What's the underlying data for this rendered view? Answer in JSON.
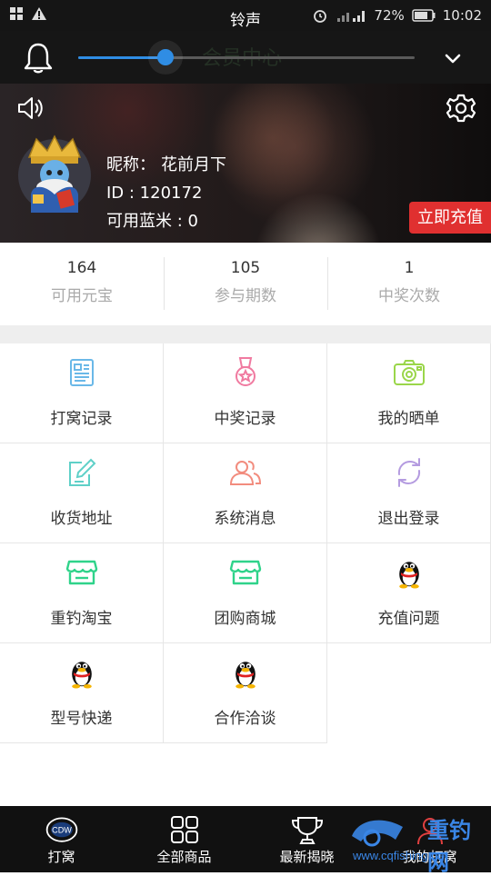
{
  "status_bar": {
    "title": "铃声",
    "battery": "72%",
    "time": "10:02"
  },
  "volume": {
    "level_fraction": 0.26
  },
  "header": {
    "page_title_ghost": "会员中心",
    "nickname_label": "昵称：",
    "nickname": "花前月下",
    "id_text": "ID : 120172",
    "balance_text": "可用蓝米 : 0",
    "recharge_button": "立即充值"
  },
  "stats": [
    {
      "value": "164",
      "label": "可用元宝"
    },
    {
      "value": "105",
      "label": "参与期数"
    },
    {
      "value": "1",
      "label": "中奖次数"
    }
  ],
  "menu": [
    {
      "label": "打窝记录",
      "icon": "document-icon",
      "color": "#6ab8e8"
    },
    {
      "label": "中奖记录",
      "icon": "medal-icon",
      "color": "#f07aa0"
    },
    {
      "label": "我的晒单",
      "icon": "camera-icon",
      "color": "#9ad64a"
    },
    {
      "label": "收货地址",
      "icon": "edit-icon",
      "color": "#5fd0c8"
    },
    {
      "label": "系统消息",
      "icon": "users-icon",
      "color": "#f28c7e"
    },
    {
      "label": "退出登录",
      "icon": "refresh-icon",
      "color": "#b49be0"
    },
    {
      "label": "重钓淘宝",
      "icon": "shop-icon",
      "color": "#2fd38a"
    },
    {
      "label": "团购商城",
      "icon": "shop-icon",
      "color": "#2fd38a"
    },
    {
      "label": "充值问题",
      "icon": "qq-penguin-icon"
    },
    {
      "label": "型号快递",
      "icon": "qq-penguin-icon"
    },
    {
      "label": "合作洽谈",
      "icon": "qq-penguin-icon"
    }
  ],
  "bottom_nav": [
    {
      "label": "打窝",
      "icon": "logo-icon"
    },
    {
      "label": "全部商品",
      "icon": "grid-icon"
    },
    {
      "label": "最新揭晓",
      "icon": "trophy-icon"
    },
    {
      "label": "我的打窝",
      "icon": "user-icon"
    }
  ],
  "watermark": {
    "line1": "重钓网",
    "line2": "www.cqfishing.net"
  }
}
